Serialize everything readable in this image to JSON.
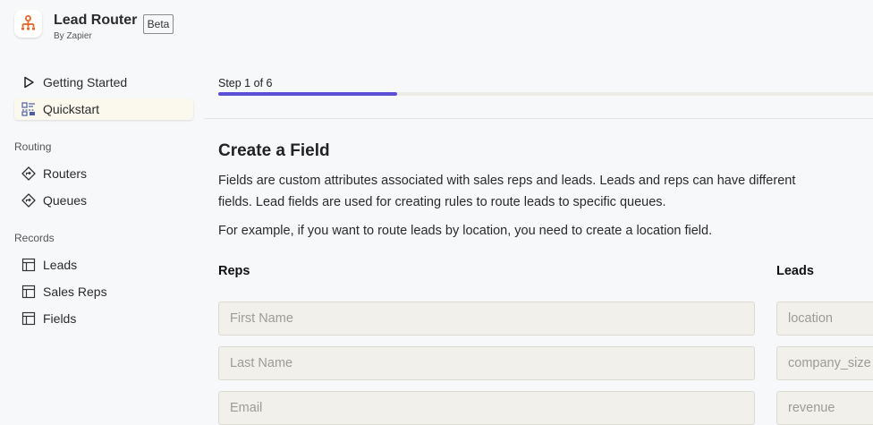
{
  "brand": {
    "title": "Lead Router",
    "subtitle": "By Zapier",
    "badge": "Beta",
    "accent": "#e0662a"
  },
  "nav": {
    "top_items": [
      {
        "label": "Getting Started",
        "icon": "play-icon"
      },
      {
        "label": "Quickstart",
        "icon": "quickstart-icon",
        "active": true
      }
    ],
    "sections": [
      {
        "title": "Routing",
        "items": [
          {
            "label": "Routers",
            "icon": "router-icon"
          },
          {
            "label": "Queues",
            "icon": "queue-icon"
          }
        ]
      },
      {
        "title": "Records",
        "items": [
          {
            "label": "Leads",
            "icon": "table-icon"
          },
          {
            "label": "Sales Reps",
            "icon": "table-icon"
          },
          {
            "label": "Fields",
            "icon": "table-icon"
          }
        ]
      }
    ]
  },
  "main": {
    "step_label": "Step 1 of 6",
    "progress": 0.27,
    "progress_color": "#5b4fd6",
    "heading": "Create a Field",
    "para1": "Fields are custom attributes associated with sales reps and leads. Leads and reps can have different fields. Lead fields are used for creating rules to route leads to specific queues.",
    "para2": "For example, if you want to route leads by location, you need to create a location field.",
    "reps": {
      "label": "Reps",
      "placeholders": [
        "First Name",
        "Last Name",
        "Email"
      ]
    },
    "leads": {
      "label": "Leads",
      "placeholders": [
        "location",
        "company_size",
        "revenue"
      ]
    }
  }
}
